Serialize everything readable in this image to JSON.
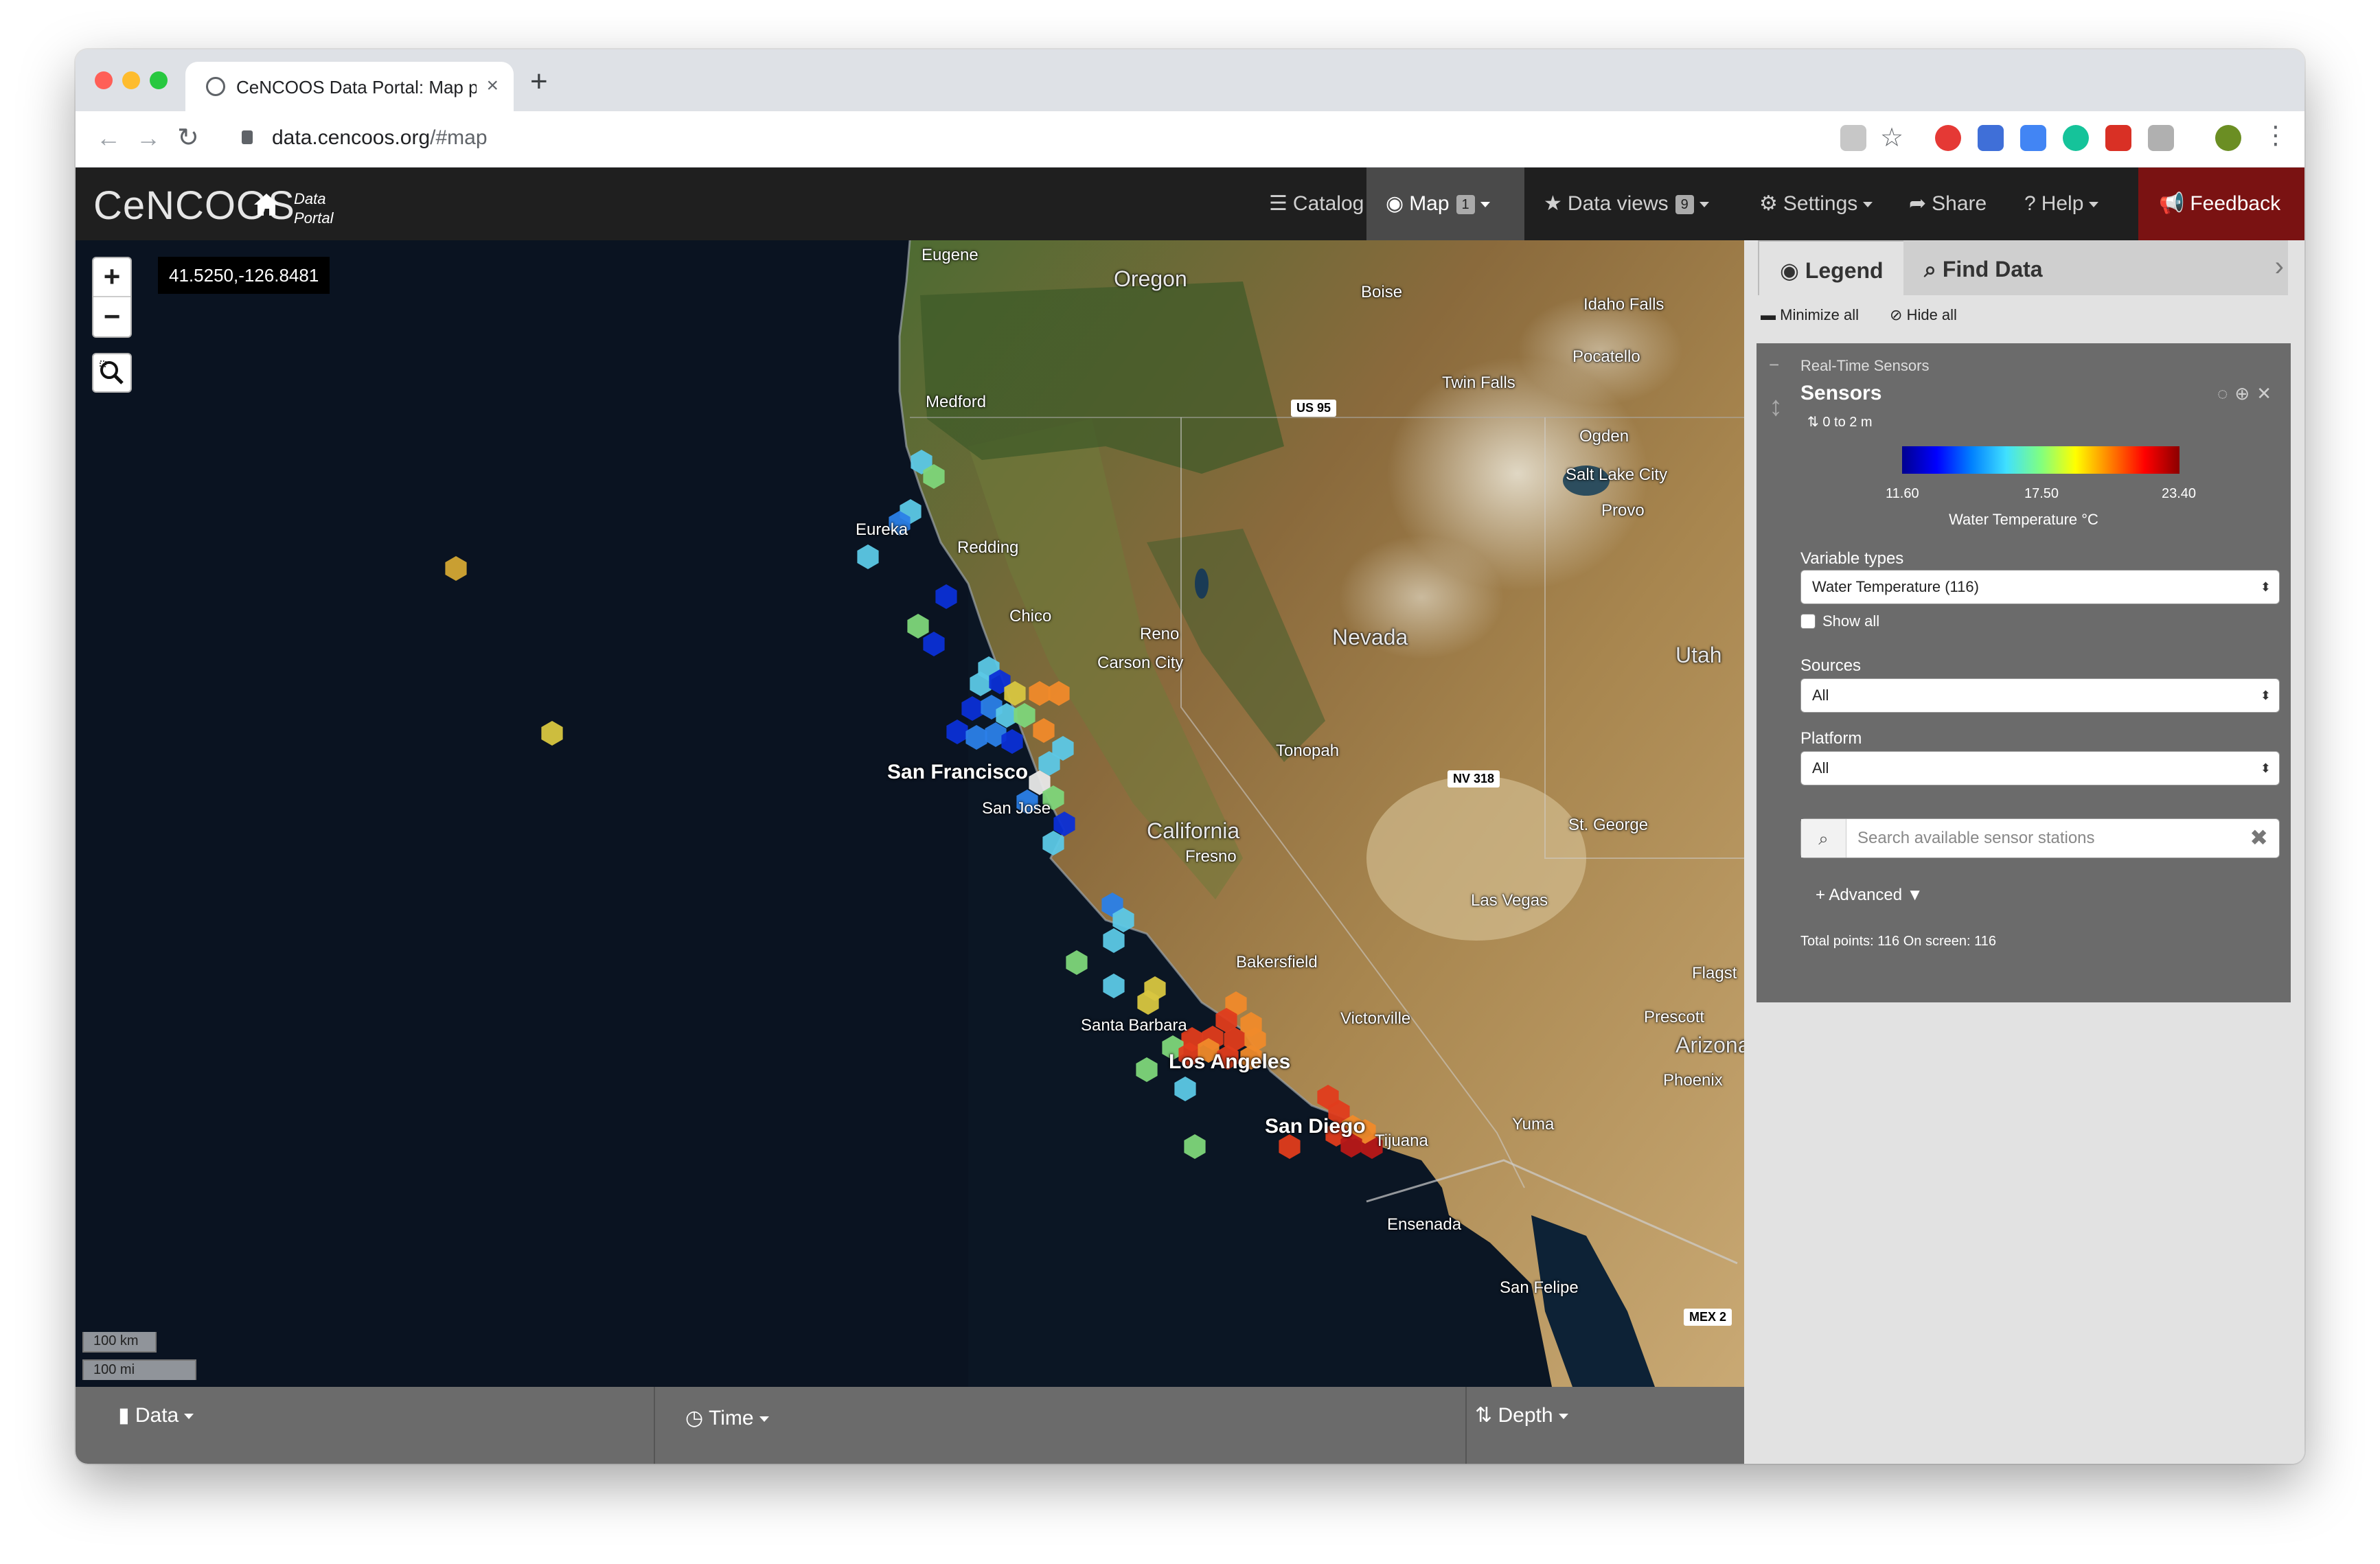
{
  "browser": {
    "tab_title": "CeNCOOS Data Portal: Map po",
    "url_domain": "data.cencoos.org",
    "url_path": "/#map"
  },
  "header": {
    "logo": "CeNCOOS",
    "portal_label_1": "Data",
    "portal_label_2": "Portal",
    "nav": {
      "catalog": "Catalog",
      "map": "Map",
      "map_count": "1",
      "data_views": "Data views",
      "data_views_count": "9",
      "settings": "Settings",
      "share": "Share",
      "help": "Help",
      "feedback": "Feedback"
    }
  },
  "map": {
    "coords": "41.5250,-126.8481",
    "zoom_in": "+",
    "zoom_out": "−",
    "scale_km": "100 km",
    "scale_mi": "100 mi",
    "labels": {
      "eugene": "Eugene",
      "oregon": "Oregon",
      "boise": "Boise",
      "idaho_falls": "Idaho Falls",
      "pocatello": "Pocatello",
      "twin_falls": "Twin Falls",
      "medford": "Medford",
      "us95": "US 95",
      "eureka": "Eureka",
      "redding": "Redding",
      "ogden": "Ogden",
      "salt_lake": "Salt Lake City",
      "provo": "Provo",
      "chico": "Chico",
      "reno": "Reno",
      "carson": "Carson City",
      "nevada": "Nevada",
      "utah": "Utah",
      "san_francisco": "San Francisco",
      "san_jose": "San Jose",
      "tonopah": "Tonopah",
      "nv318": "NV 318",
      "california": "California",
      "fresno": "Fresno",
      "st_george": "St. George",
      "las_vegas": "Las Vegas",
      "bakersfield": "Bakersfield",
      "flagstaff": "Flagst",
      "victorville": "Victorville",
      "prescott": "Prescott",
      "arizona": "Arizona",
      "santa_barbara": "Santa Barbara",
      "los_angeles": "Los Angeles",
      "phoenix": "Phoenix",
      "san_diego": "San Diego",
      "tijuana": "Tijuana",
      "yuma": "Yuma",
      "ensenada": "Ensenada",
      "san_felipe": "San Felipe",
      "mex2": "MEX 2"
    },
    "sensor_colors": {
      "cold": "#0b2fd6",
      "cool": "#2b7fe8",
      "cyan": "#5cc8e6",
      "green": "#7ed67a",
      "yellow": "#d8c640",
      "orange": "#f08a2a",
      "red": "#e03c1c",
      "darkred": "#b81818",
      "offshore_yellow": "#d4a734"
    }
  },
  "bottom": {
    "data": "Data",
    "time": "Time",
    "depth": "Depth"
  },
  "panel": {
    "tab_legend": "Legend",
    "tab_find": "Find Data",
    "minimize_all": "Minimize all",
    "hide_all": "Hide all",
    "group": "Real-Time Sensors",
    "layer_title": "Sensors",
    "depth_range": "0 to 2 m",
    "colorbar": {
      "min": "11.60",
      "mid": "17.50",
      "max": "23.40",
      "label": "Water Temperature °C"
    },
    "variable_types_label": "Variable types",
    "variable_types_value": "Water Temperature (116)",
    "show_all": "Show all",
    "sources_label": "Sources",
    "sources_value": "All",
    "platform_label": "Platform",
    "platform_value": "All",
    "search_placeholder": "Search available sensor stations",
    "advanced": "Advanced",
    "totals": "Total points: 116 On screen: 116"
  }
}
